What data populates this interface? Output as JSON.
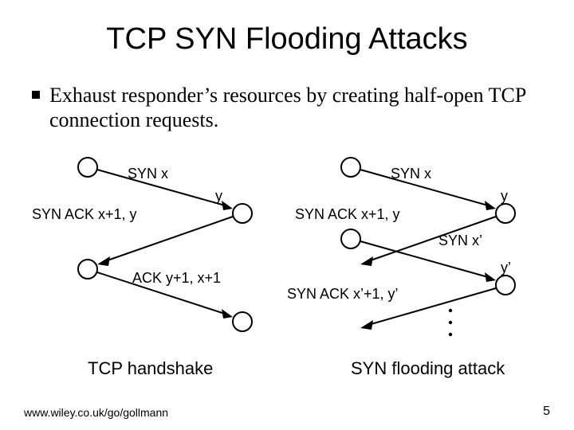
{
  "title": "TCP SYN Flooding Attacks",
  "bullet": "Exhaust responder’s resources by creating half-open TCP connection requests.",
  "diagram": {
    "left": {
      "msg1": "SYN x",
      "msg1_end": "y",
      "msg2": "SYN ACK x+1, y",
      "msg3": "ACK y+1, x+1",
      "caption": "TCP handshake"
    },
    "right": {
      "msg1": "SYN x",
      "msg1_end": "y",
      "msg2": "SYN ACK x+1, y",
      "msg3": "SYN x’",
      "msg3_end": "y’",
      "msg4": "SYN ACK x’+1, y’",
      "dots": "•\n•\n•",
      "caption": "SYN flooding attack"
    }
  },
  "footer": "www.wiley.co.uk/go/gollmann",
  "page_number": "5"
}
